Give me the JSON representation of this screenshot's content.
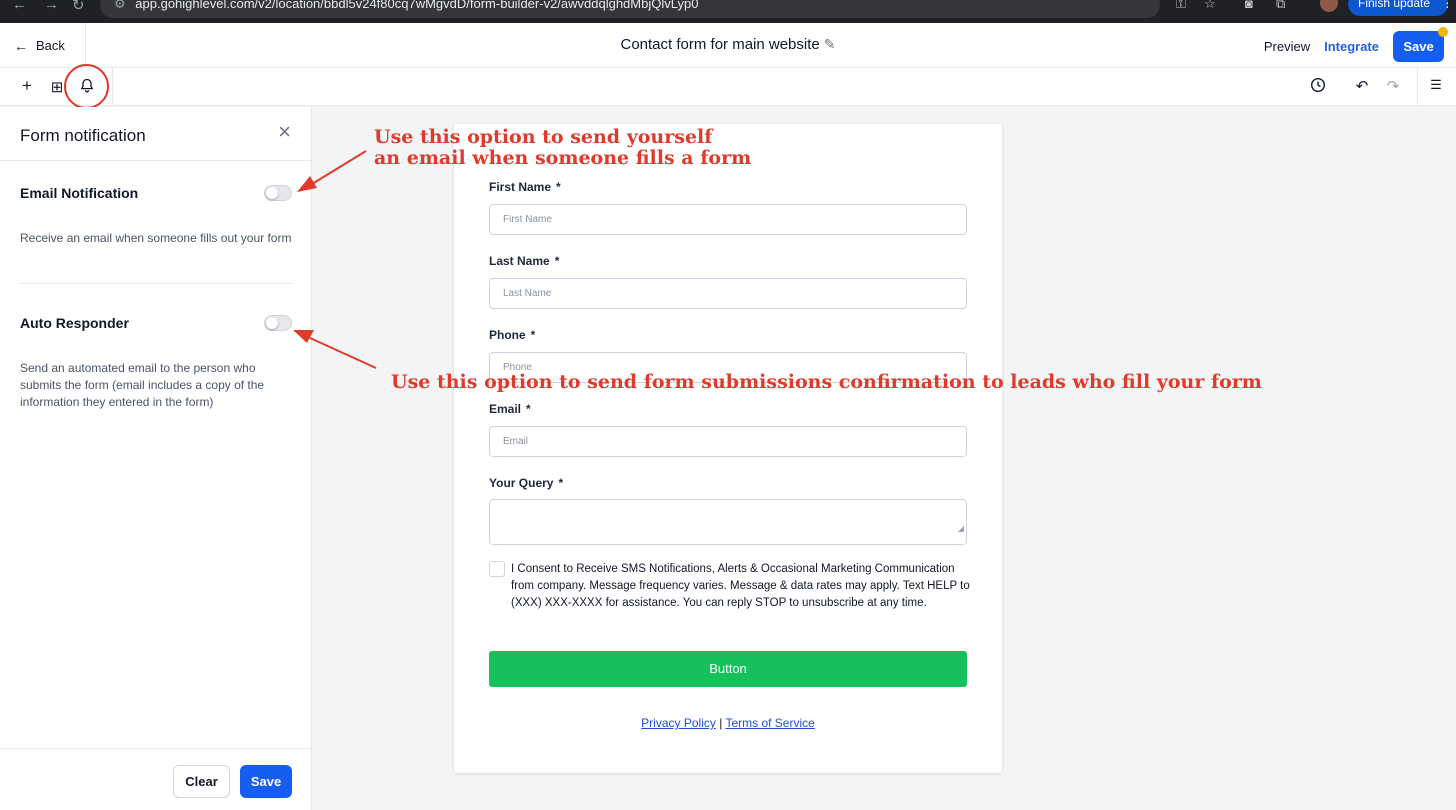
{
  "browser": {
    "url": "app.gohighlevel.com/v2/location/bbdl5v24f80cq7wMgvdD/form-builder-v2/awvddqlghdMbjQlvLyp0",
    "finish_update_label": "Finish update",
    "menu_glyph": "⋮"
  },
  "header": {
    "back_label": "Back",
    "title": "Contact form for main website",
    "preview_label": "Preview",
    "integrate_label": "Integrate",
    "save_label": "Save"
  },
  "toolbar": {
    "left_icons": [
      "plus-icon",
      "layout-icon",
      "bell-icon"
    ],
    "right_icons": [
      "history-icon",
      "undo-icon",
      "redo-icon",
      "settings-sliders-icon"
    ]
  },
  "sidebar": {
    "title": "Form notification",
    "sections": [
      {
        "title": "Email Notification",
        "description": "Receive an email when someone fills out your form",
        "enabled": false
      },
      {
        "title": "Auto Responder",
        "description": "Send an automated email to the person who submits the form (email includes a copy of the information they entered in the form)",
        "enabled": false
      }
    ],
    "clear_label": "Clear",
    "save_label": "Save"
  },
  "form": {
    "fields": [
      {
        "label": "First Name",
        "required_mark": "*",
        "placeholder": "First Name"
      },
      {
        "label": "Last Name",
        "required_mark": "*",
        "placeholder": "Last Name"
      },
      {
        "label": "Phone",
        "required_mark": "*",
        "placeholder": "Phone"
      },
      {
        "label": "Email",
        "required_mark": "*",
        "placeholder": "Email"
      },
      {
        "label": "Your Query",
        "required_mark": "*",
        "placeholder": ""
      }
    ],
    "consent_text": "I Consent to Receive SMS Notifications, Alerts & Occasional Marketing Communication from company. Message frequency varies. Message & data rates may apply. Text HELP to (XXX) XXX-XXXX for assistance. You can reply STOP to unsubscribe at any time.",
    "button_label": "Button",
    "privacy_label": "Privacy Policy",
    "separator": "|",
    "terms_label": "Terms of Service"
  },
  "annotations": {
    "email_line1": "Use this option to send yourself",
    "email_line2": "an email when someone fills a form",
    "auto": "Use this option to send form submissions confirmation to leads who fill your form",
    "color": "#e03a2b"
  },
  "colors": {
    "primary": "#155eef",
    "form_button": "#16c05b",
    "annotation": "#e03a2b"
  }
}
